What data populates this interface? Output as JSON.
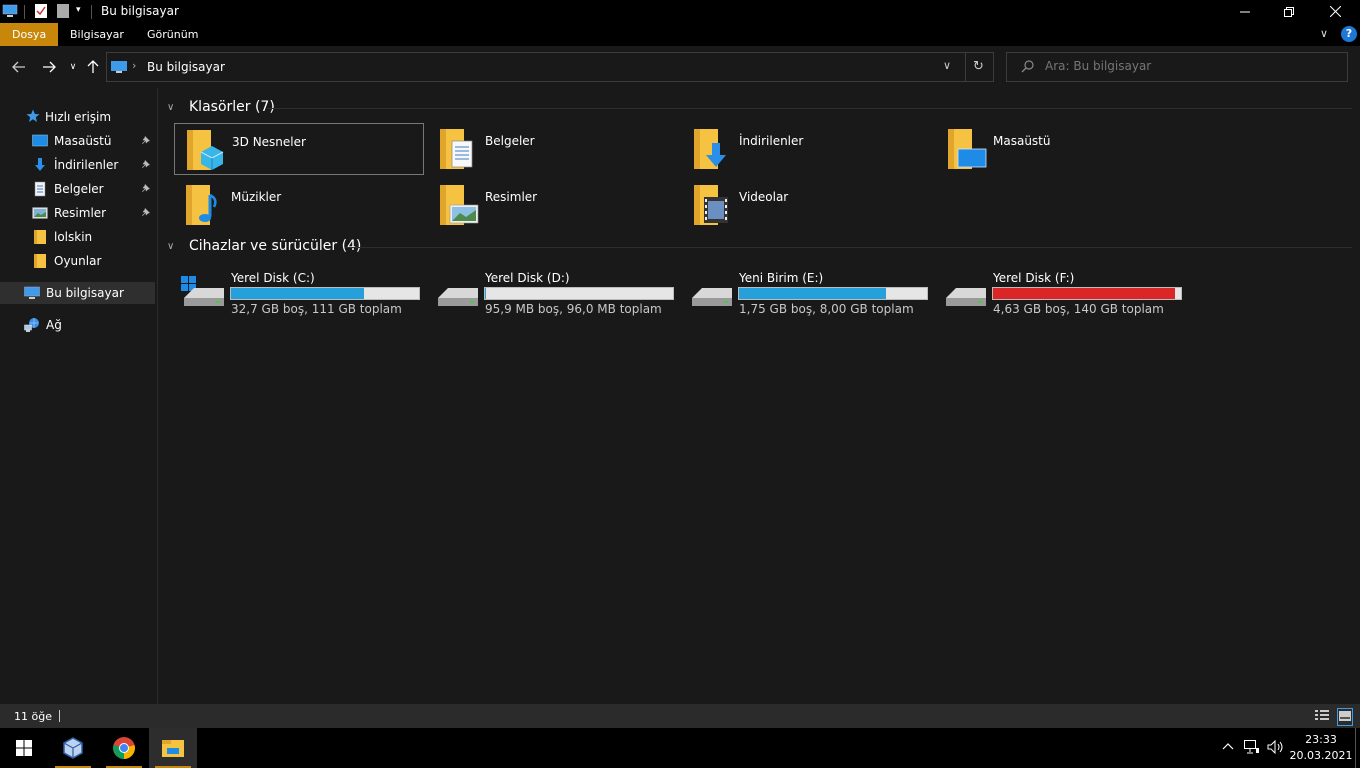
{
  "window": {
    "title": "Bu bilgisayar"
  },
  "ribbon": {
    "tabs": [
      {
        "label": "Dosya",
        "active": true
      },
      {
        "label": "Bilgisayar",
        "active": false
      },
      {
        "label": "Görünüm",
        "active": false
      }
    ]
  },
  "address": {
    "breadcrumb": "Bu bilgisayar",
    "search_placeholder": "Ara: Bu bilgisayar"
  },
  "sidebar": {
    "quick_access": "Hızlı erişim",
    "items": [
      {
        "label": "Masaüstü",
        "pinned": true,
        "icon": "desktop-icon"
      },
      {
        "label": "İndirilenler",
        "pinned": true,
        "icon": "downloads-icon"
      },
      {
        "label": "Belgeler",
        "pinned": true,
        "icon": "documents-icon"
      },
      {
        "label": "Resimler",
        "pinned": true,
        "icon": "pictures-icon"
      },
      {
        "label": "lolskin",
        "pinned": false,
        "icon": "folder-icon"
      },
      {
        "label": "Oyunlar",
        "pinned": false,
        "icon": "folder-icon"
      }
    ],
    "this_pc": "Bu bilgisayar",
    "network": "Ağ"
  },
  "content": {
    "folders_header": "Klasörler (7)",
    "folders": [
      {
        "label": "3D Nesneler",
        "icon": "3d-objects-icon",
        "selected": true
      },
      {
        "label": "Belgeler",
        "icon": "documents-folder-icon",
        "selected": false
      },
      {
        "label": "İndirilenler",
        "icon": "downloads-folder-icon",
        "selected": false
      },
      {
        "label": "Masaüstü",
        "icon": "desktop-folder-icon",
        "selected": false
      },
      {
        "label": "Müzikler",
        "icon": "music-folder-icon",
        "selected": false
      },
      {
        "label": "Resimler",
        "icon": "pictures-folder-icon",
        "selected": false
      },
      {
        "label": "Videolar",
        "icon": "videos-folder-icon",
        "selected": false
      }
    ],
    "drives_header": "Cihazlar ve sürücüler (4)",
    "drives": [
      {
        "label": "Yerel Disk (C:)",
        "info": "32,7 GB boş, 111 GB toplam",
        "used_fraction": 0.705,
        "bar_color": "#26a0da"
      },
      {
        "label": "Yerel Disk (D:)",
        "info": "95,9 MB boş, 96,0 MB toplam",
        "used_fraction": 0.001,
        "bar_color": "#26a0da"
      },
      {
        "label": "Yeni Birim (E:)",
        "info": "1,75 GB boş, 8,00 GB toplam",
        "used_fraction": 0.78,
        "bar_color": "#26a0da"
      },
      {
        "label": "Yerel Disk (F:)",
        "info": "4,63 GB boş, 140 GB toplam",
        "used_fraction": 0.967,
        "bar_color": "#da2626"
      }
    ]
  },
  "status": {
    "item_count": "11 öğe"
  },
  "taskbar": {
    "time": "23:33",
    "date": "20.03.2021"
  },
  "colors": {
    "accent": "#c8860a",
    "folder": "#f5c242",
    "bar_blue": "#26a0da",
    "bar_red": "#da2626"
  }
}
